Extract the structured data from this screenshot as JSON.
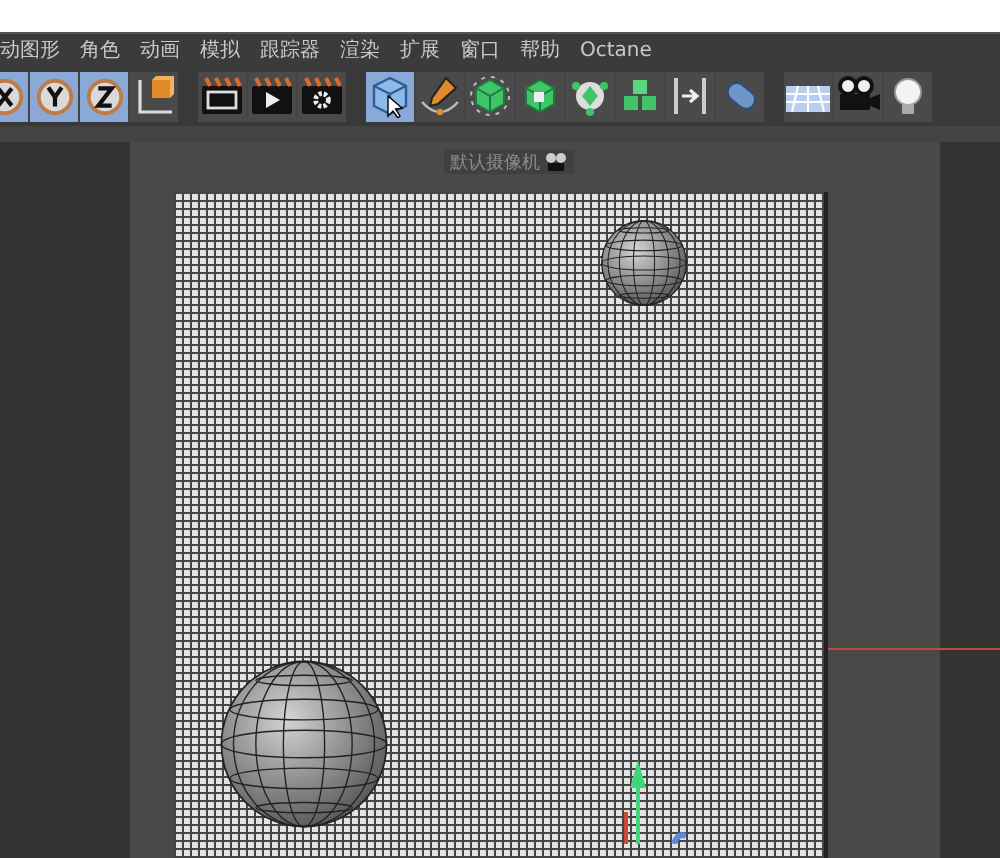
{
  "menu": [
    {
      "label": "动图形"
    },
    {
      "label": "角色"
    },
    {
      "label": "动画"
    },
    {
      "label": "模拟"
    },
    {
      "label": "跟踪器"
    },
    {
      "label": "渲染"
    },
    {
      "label": "扩展"
    },
    {
      "label": "窗口"
    },
    {
      "label": "帮助"
    },
    {
      "label": "Octane"
    }
  ],
  "toolbar": [
    [
      {
        "kind": "axis-x",
        "selected": true
      },
      {
        "kind": "axis-y",
        "selected": true
      },
      {
        "kind": "axis-z",
        "selected": true
      },
      {
        "kind": "coords",
        "selected": false
      }
    ],
    [
      {
        "kind": "render-view",
        "selected": false
      },
      {
        "kind": "render-play",
        "selected": false
      },
      {
        "kind": "render-settings",
        "selected": false
      }
    ],
    [
      {
        "kind": "cube",
        "selected": true
      },
      {
        "kind": "pen",
        "selected": false
      },
      {
        "kind": "subdiv",
        "selected": false
      },
      {
        "kind": "extrude",
        "selected": false
      },
      {
        "kind": "cloner",
        "selected": false
      },
      {
        "kind": "effector",
        "selected": false
      },
      {
        "kind": "deformer",
        "selected": false
      },
      {
        "kind": "capsule",
        "selected": false
      }
    ],
    [
      {
        "kind": "floor",
        "selected": false
      },
      {
        "kind": "camera",
        "selected": false
      },
      {
        "kind": "light",
        "selected": false
      }
    ]
  ],
  "viewport": {
    "camera_label": "默认摄像机"
  }
}
